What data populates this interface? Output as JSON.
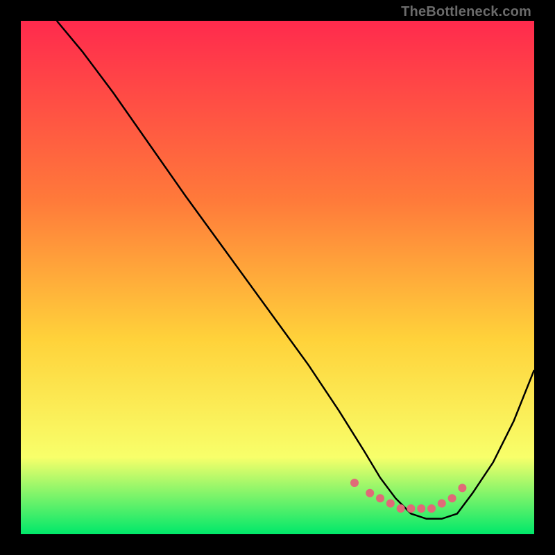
{
  "watermark": "TheBottleneck.com",
  "gradient": {
    "top": "#ff2a4d",
    "mid1": "#ff7a3a",
    "mid2": "#ffd23a",
    "mid3": "#f8ff6a",
    "bottom": "#00e86a"
  },
  "curve_color": "#000000",
  "marker_color": "#e06a78",
  "chart_data": {
    "type": "line",
    "title": "",
    "xlabel": "",
    "ylabel": "",
    "xlim": [
      0,
      100
    ],
    "ylim": [
      0,
      100
    ],
    "series": [
      {
        "name": "bottleneck-curve",
        "x": [
          7,
          12,
          18,
          25,
          32,
          40,
          48,
          56,
          62,
          67,
          70,
          73,
          76,
          79,
          82,
          85,
          88,
          92,
          96,
          100
        ],
        "y": [
          100,
          94,
          86,
          76,
          66,
          55,
          44,
          33,
          24,
          16,
          11,
          7,
          4,
          3,
          3,
          4,
          8,
          14,
          22,
          32
        ]
      }
    ],
    "markers": {
      "name": "highlight-points",
      "x": [
        65,
        68,
        70,
        72,
        74,
        76,
        78,
        80,
        82,
        84,
        86
      ],
      "y": [
        10,
        8,
        7,
        6,
        5,
        5,
        5,
        5,
        6,
        7,
        9
      ]
    }
  }
}
